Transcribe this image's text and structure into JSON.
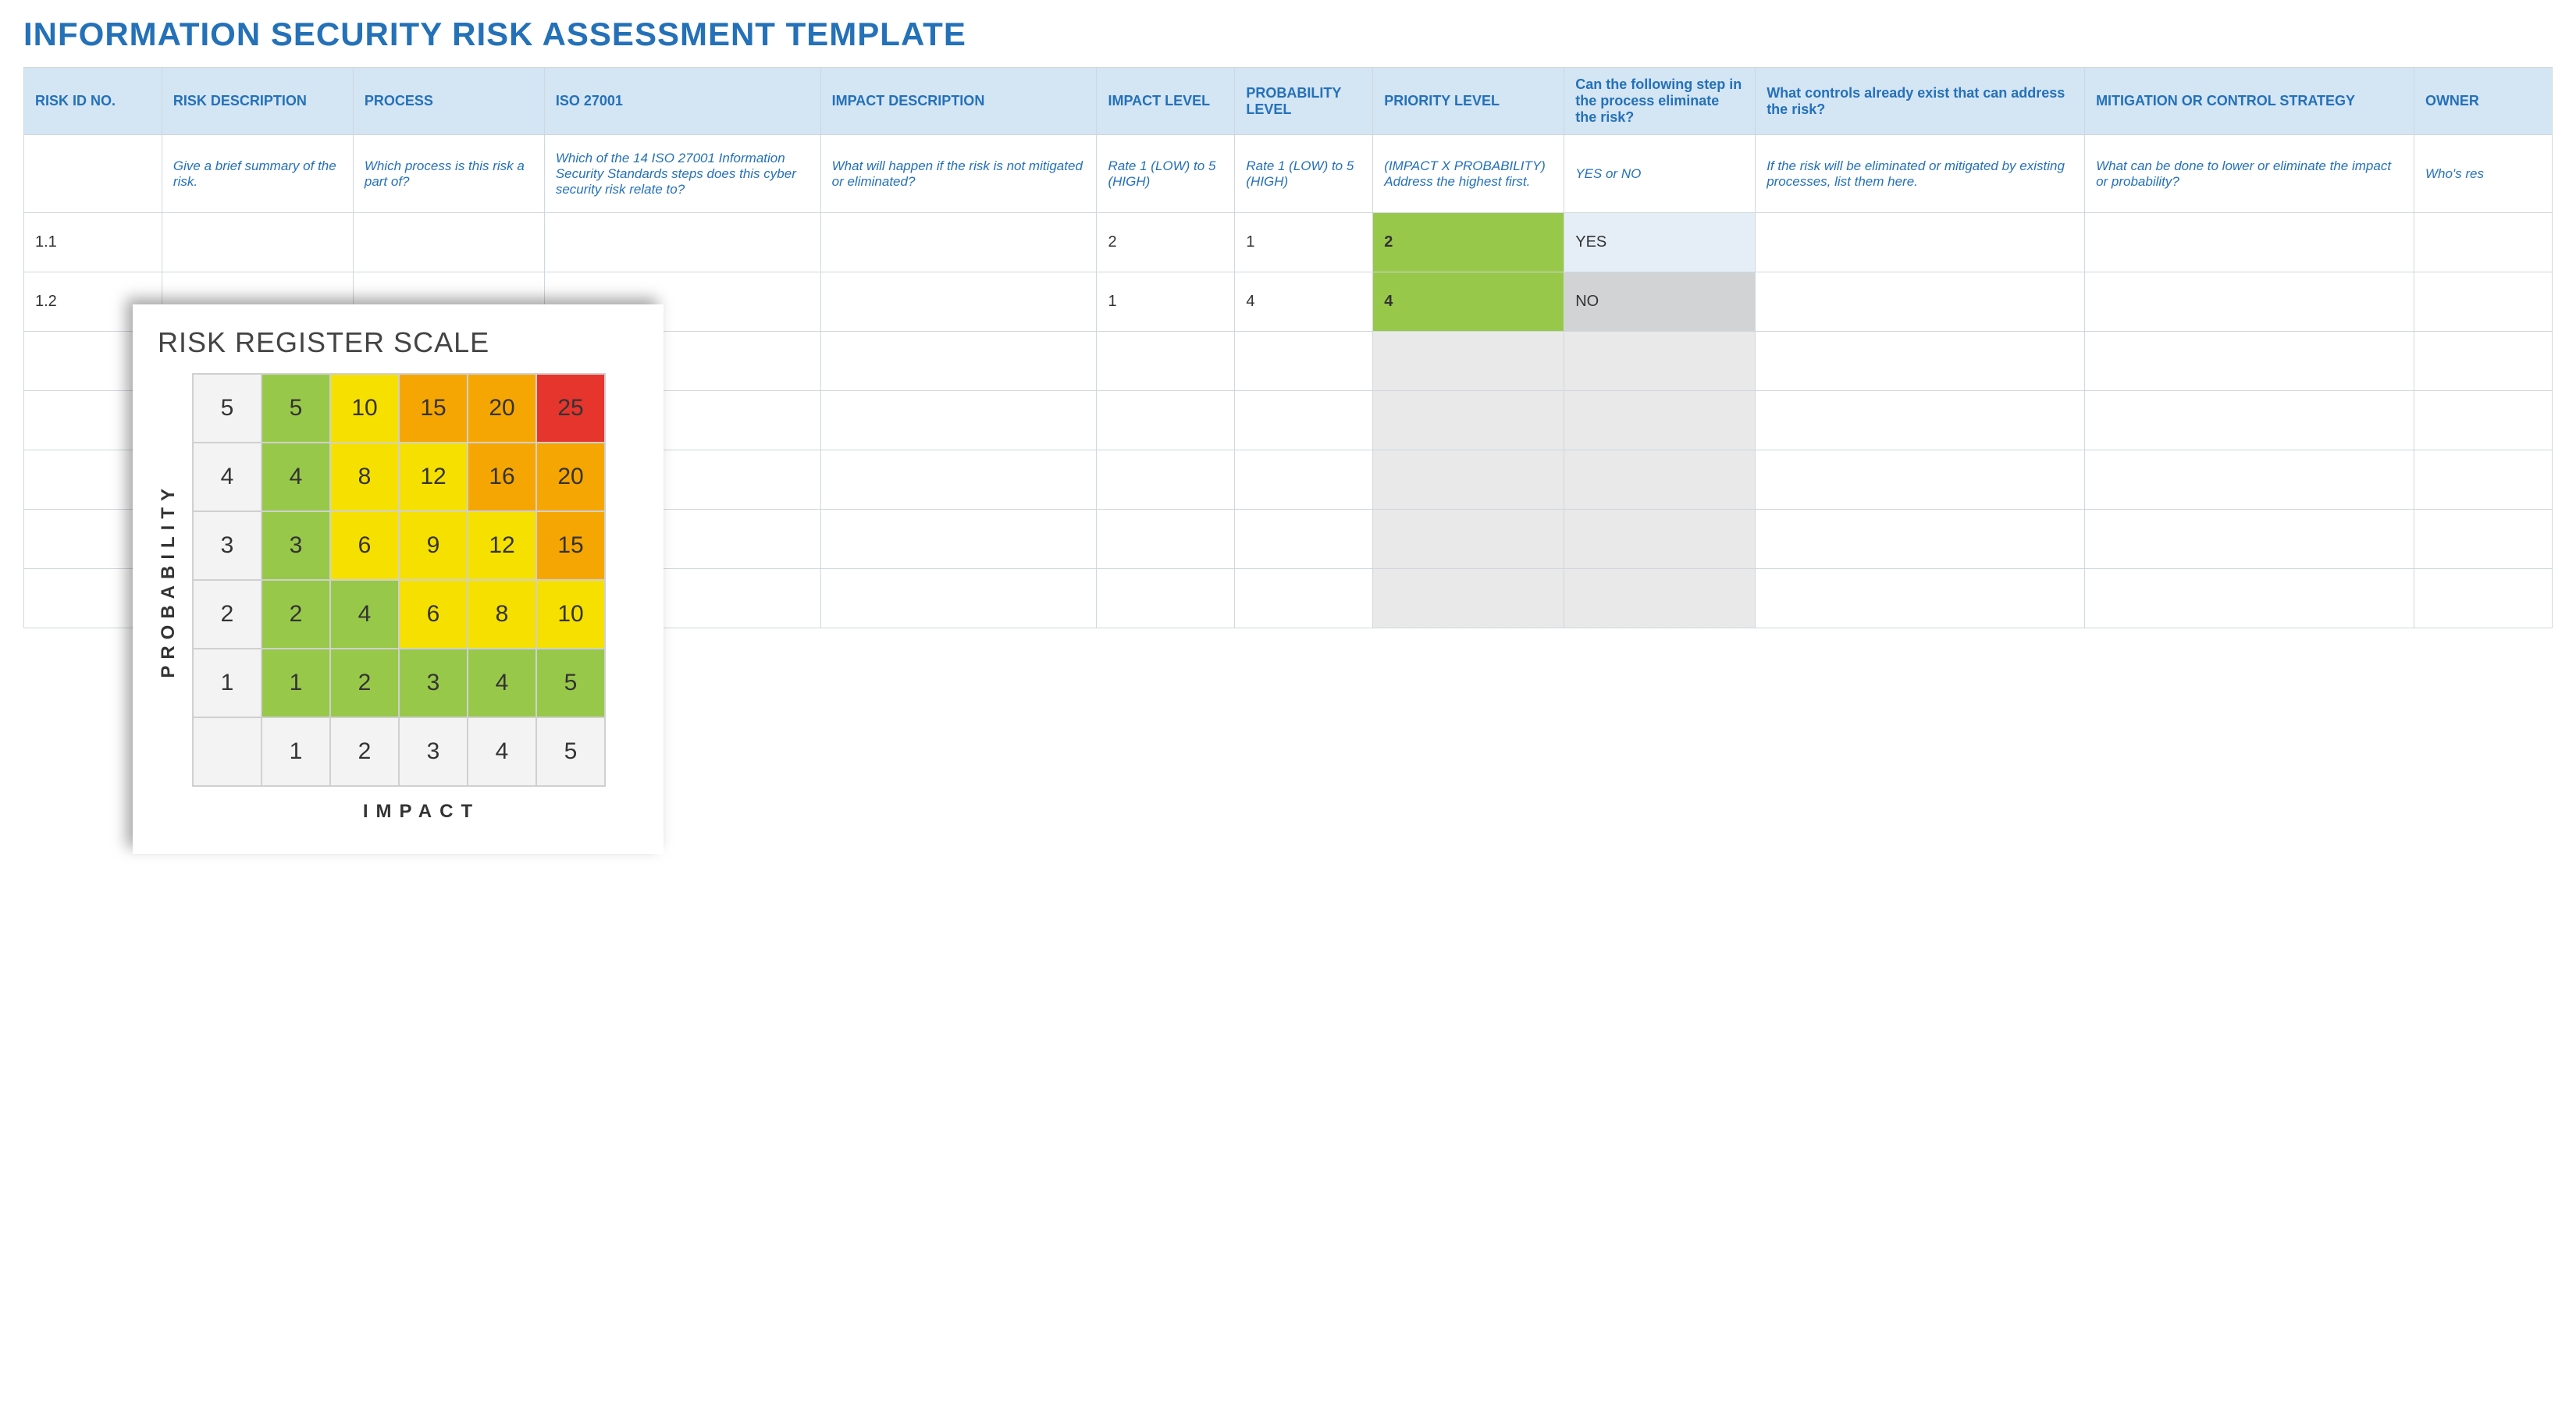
{
  "title": "INFORMATION SECURITY RISK ASSESSMENT TEMPLATE",
  "headers": {
    "risk_id": "RISK ID NO.",
    "risk_desc": "RISK DESCRIPTION",
    "process": "PROCESS",
    "iso": "ISO 27001",
    "impact_desc": "IMPACT DESCRIPTION",
    "impact_level": "IMPACT LEVEL",
    "prob_level": "PROBABILITY LEVEL",
    "priority": "PRIORITY LEVEL",
    "eliminate": "Can the following step in the process eliminate the risk?",
    "controls": "What controls already exist that can address the risk?",
    "mitigation": "MITIGATION OR CONTROL STRATEGY",
    "owner": "OWNER"
  },
  "hints": {
    "risk_id": "",
    "risk_desc": "Give a brief summary of the risk.",
    "process": "Which process is this risk a part of?",
    "iso": "Which of the 14 ISO 27001 Information Security Standards steps does this cyber security risk relate to?",
    "impact_desc": "What will happen if the risk is not mitigated or eliminated?",
    "impact_level": "Rate 1 (LOW) to 5 (HIGH)",
    "prob_level": "Rate 1 (LOW) to 5 (HIGH)",
    "priority": "(IMPACT X PROBABILITY) Address the highest first.",
    "eliminate": "YES or NO",
    "controls": "If the risk will be eliminated or mitigated by existing processes, list them here.",
    "mitigation": "What can be done to lower or eliminate the impact or probability?",
    "owner": "Who's res"
  },
  "rows": [
    {
      "id": "1.1",
      "impact": "2",
      "prob": "1",
      "priority": "2",
      "eliminate": "YES"
    },
    {
      "id": "1.2",
      "impact": "1",
      "prob": "4",
      "priority": "4",
      "eliminate": "NO"
    },
    {
      "id": "",
      "impact": "",
      "prob": "",
      "priority": "",
      "eliminate": ""
    },
    {
      "id": "",
      "impact": "",
      "prob": "",
      "priority": "",
      "eliminate": ""
    },
    {
      "id": "",
      "impact": "",
      "prob": "",
      "priority": "",
      "eliminate": ""
    },
    {
      "id": "",
      "impact": "",
      "prob": "",
      "priority": "",
      "eliminate": ""
    },
    {
      "id": "",
      "impact": "",
      "prob": "",
      "priority": "",
      "eliminate": ""
    }
  ],
  "card": {
    "title": "RISK REGISTER SCALE",
    "ylabel": "PROBABILITY",
    "xlabel": "IMPACT",
    "prob_headers": [
      "5",
      "4",
      "3",
      "2",
      "1"
    ],
    "impact_headers": [
      "1",
      "2",
      "3",
      "4",
      "5"
    ],
    "matrix": [
      [
        {
          "v": "5",
          "c": "g"
        },
        {
          "v": "10",
          "c": "y"
        },
        {
          "v": "15",
          "c": "o"
        },
        {
          "v": "20",
          "c": "o"
        },
        {
          "v": "25",
          "c": "r"
        }
      ],
      [
        {
          "v": "4",
          "c": "g"
        },
        {
          "v": "8",
          "c": "y"
        },
        {
          "v": "12",
          "c": "y"
        },
        {
          "v": "16",
          "c": "o"
        },
        {
          "v": "20",
          "c": "o"
        }
      ],
      [
        {
          "v": "3",
          "c": "g"
        },
        {
          "v": "6",
          "c": "y"
        },
        {
          "v": "9",
          "c": "y"
        },
        {
          "v": "12",
          "c": "y"
        },
        {
          "v": "15",
          "c": "o"
        }
      ],
      [
        {
          "v": "2",
          "c": "g"
        },
        {
          "v": "4",
          "c": "g"
        },
        {
          "v": "6",
          "c": "y"
        },
        {
          "v": "8",
          "c": "y"
        },
        {
          "v": "10",
          "c": "y"
        }
      ],
      [
        {
          "v": "1",
          "c": "g"
        },
        {
          "v": "2",
          "c": "g"
        },
        {
          "v": "3",
          "c": "g"
        },
        {
          "v": "4",
          "c": "g"
        },
        {
          "v": "5",
          "c": "g"
        }
      ]
    ]
  },
  "chart_data": {
    "type": "heatmap",
    "title": "RISK REGISTER SCALE",
    "xlabel": "IMPACT",
    "ylabel": "PROBABILITY",
    "x": [
      1,
      2,
      3,
      4,
      5
    ],
    "y": [
      5,
      4,
      3,
      2,
      1
    ],
    "values": [
      [
        5,
        10,
        15,
        20,
        25
      ],
      [
        4,
        8,
        12,
        16,
        20
      ],
      [
        3,
        6,
        9,
        12,
        15
      ],
      [
        2,
        4,
        6,
        8,
        10
      ],
      [
        1,
        2,
        3,
        4,
        5
      ]
    ],
    "color_scale": [
      {
        "range": [
          1,
          5
        ],
        "color": "#98c84a"
      },
      {
        "range": [
          6,
          12
        ],
        "color": "#f5e000"
      },
      {
        "range": [
          13,
          20
        ],
        "color": "#f6a602"
      },
      {
        "range": [
          21,
          25
        ],
        "color": "#e5352d"
      }
    ]
  }
}
